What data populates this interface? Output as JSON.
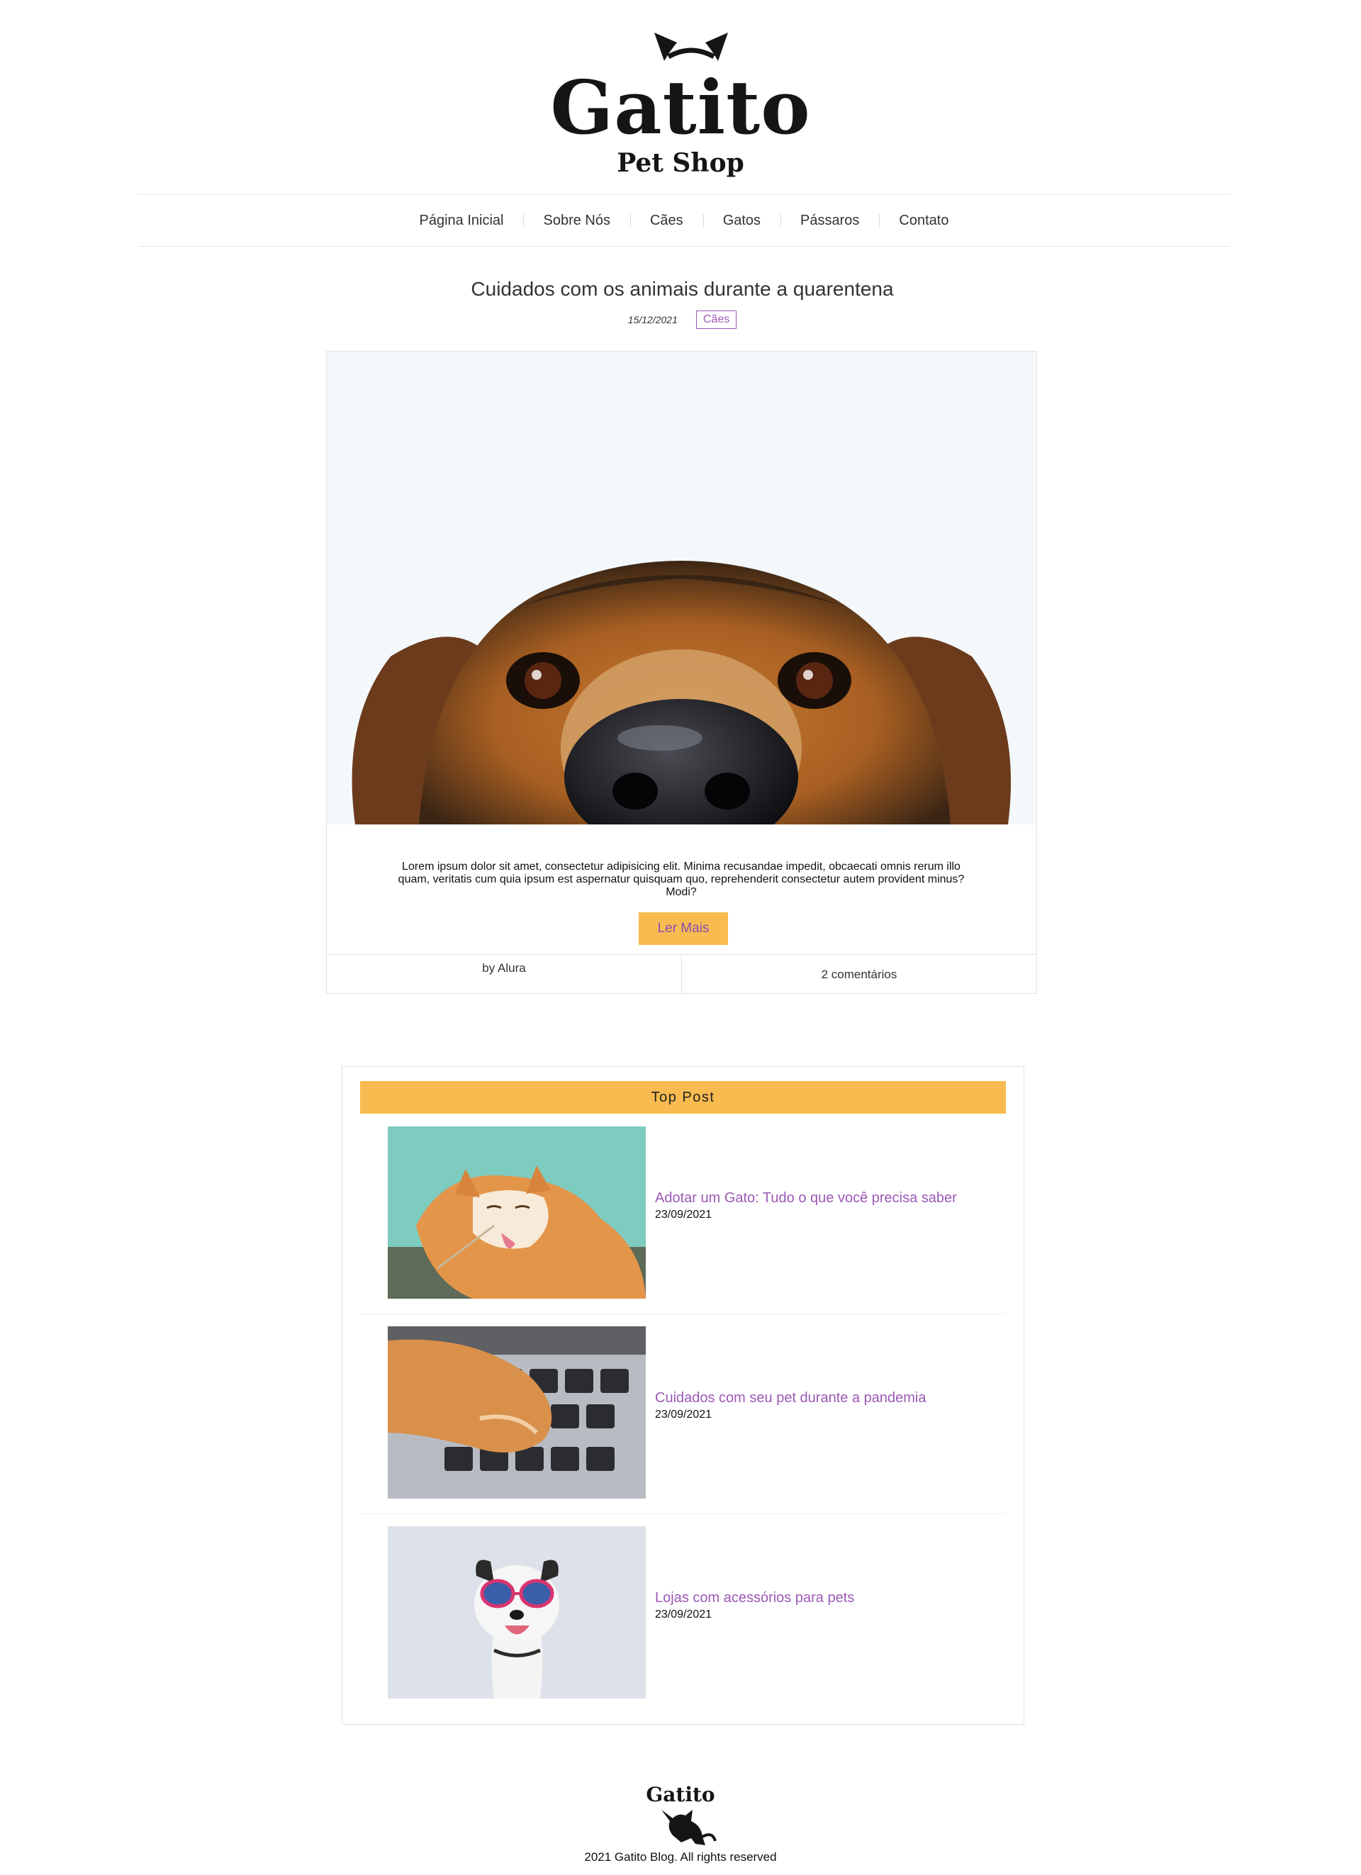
{
  "brand": {
    "name": "Gatito",
    "tagline": "Pet Shop"
  },
  "nav": {
    "items": [
      "Página Inicial",
      "Sobre Nós",
      "Cães",
      "Gatos",
      "Pássaros",
      "Contato"
    ]
  },
  "post": {
    "title": "Cuidados com os animais durante a quarentena",
    "date": "15/12/2021",
    "category": "Cães",
    "image_icon": "dog-photo",
    "excerpt": "Lorem ipsum dolor sit amet, consectetur adipisicing elit. Minima recusandae impedit, obcaecati omnis rerum illo quam, veritatis cum quia ipsum est aspernatur quisquam quo, reprehenderit consectetur autem provident minus? Modi?",
    "read_more": "Ler Mais",
    "author": "by Alura",
    "comments": "2 comentários"
  },
  "top_posts": {
    "heading": "Top Post",
    "items": [
      {
        "title": "Adotar um Gato: Tudo o que você precisa saber",
        "date": "23/09/2021",
        "image_icon": "cat-photo"
      },
      {
        "title": "Cuidados com seu pet durante a pandemia",
        "date": "23/09/2021",
        "image_icon": "cat-paw-keyboard-photo"
      },
      {
        "title": "Lojas com acessórios para pets",
        "date": "23/09/2021",
        "image_icon": "dog-sunglasses-photo"
      }
    ]
  },
  "footer": {
    "logo_text": "Gatito",
    "copyright": "2021 Gatito Blog. All rights reserved"
  },
  "colors": {
    "accent": "#f8bb4f",
    "link": "#9b59b6",
    "text": "#333333"
  }
}
